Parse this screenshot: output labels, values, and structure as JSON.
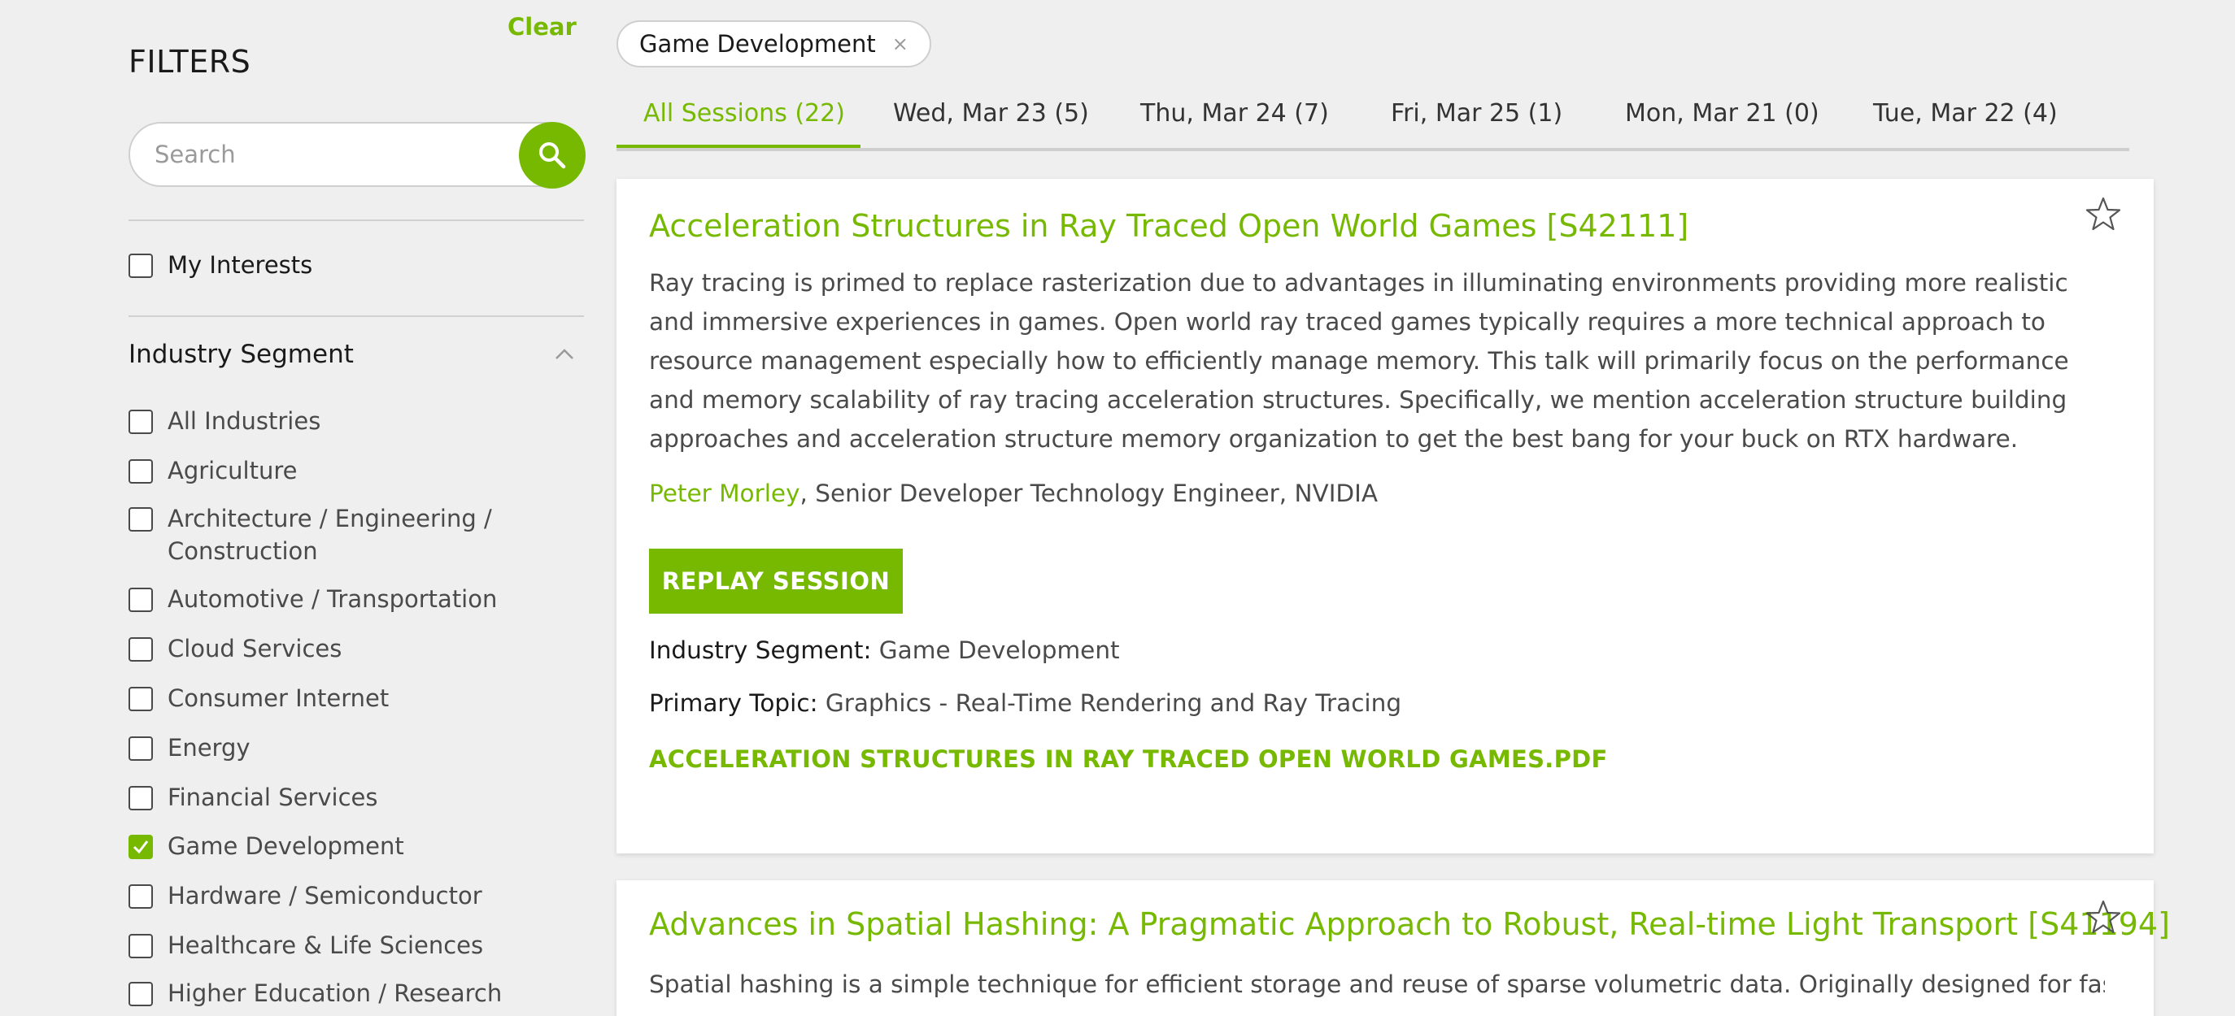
{
  "sidebar": {
    "title": "FILTERS",
    "clear_label": "Clear",
    "search_placeholder": "Search",
    "my_interests_label": "My Interests",
    "segment_title": "Industry Segment",
    "segment_items": [
      {
        "label": "All Industries",
        "checked": false
      },
      {
        "label": "Agriculture",
        "checked": false
      },
      {
        "label": "Architecture / Engineering /",
        "label2": "Construction",
        "checked": false
      },
      {
        "label": "Automotive / Transportation",
        "checked": false
      },
      {
        "label": "Cloud Services",
        "checked": false
      },
      {
        "label": "Consumer Internet",
        "checked": false
      },
      {
        "label": "Energy",
        "checked": false
      },
      {
        "label": "Financial Services",
        "checked": false
      },
      {
        "label": "Game Development",
        "checked": true
      },
      {
        "label": "Hardware / Semiconductor",
        "checked": false
      },
      {
        "label": "Healthcare & Life Sciences",
        "checked": false
      },
      {
        "label": "Higher Education / Research",
        "checked": false
      }
    ]
  },
  "active_filter": {
    "label": "Game Development",
    "remove_glyph": "×"
  },
  "tabs": [
    {
      "label": "All Sessions (22)",
      "active": true
    },
    {
      "label": "Wed, Mar 23 (5)",
      "active": false
    },
    {
      "label": "Thu, Mar 24 (7)",
      "active": false
    },
    {
      "label": "Fri, Mar 25 (1)",
      "active": false
    },
    {
      "label": "Mon, Mar 21 (0)",
      "active": false
    },
    {
      "label": "Tue, Mar 22 (4)",
      "active": false
    }
  ],
  "sessions": [
    {
      "title": "Acceleration Structures in Ray Traced Open World Games [S42111]",
      "description": "Ray tracing is primed to replace rasterization due to advantages in illuminating environments providing more realistic and immersive experiences in games. Open world ray traced games typically requires a more technical approach to resource management especially how to efficiently manage memory. This talk will primarily focus on the performance and memory scalability of ray tracing acceleration structures. Specifically, we mention acceleration structure building approaches and acceleration structure memory organization to get the best bang for your buck on RTX hardware.",
      "speaker_name": "Peter Morley",
      "speaker_role": ", Senior Developer Technology Engineer, NVIDIA",
      "button_label": "REPLAY SESSION",
      "industry_label": "Industry Segment:",
      "industry_value": " Game Development",
      "topic_label": "Primary Topic:",
      "topic_value": " Graphics - Real-Time Rendering and Ray Tracing",
      "pdf_label": "ACCELERATION STRUCTURES IN RAY TRACED OPEN WORLD GAMES.PDF"
    },
    {
      "title": "Advances in Spatial Hashing: A Pragmatic Approach to Robust, Real-time Light Transport [S41194]",
      "description": "Spatial hashing is a simple technique for efficient storage and reuse of sparse volumetric data. Originally designed for fast final"
    }
  ],
  "colors": {
    "accent": "#76b900",
    "background": "#efefef",
    "text": "#1a1a1a",
    "muted": "#4a4a4a"
  },
  "icons": {
    "search": "search-icon",
    "star": "star-outline-icon",
    "chevron": "chevron-up-icon",
    "check": "checkmark-icon"
  }
}
